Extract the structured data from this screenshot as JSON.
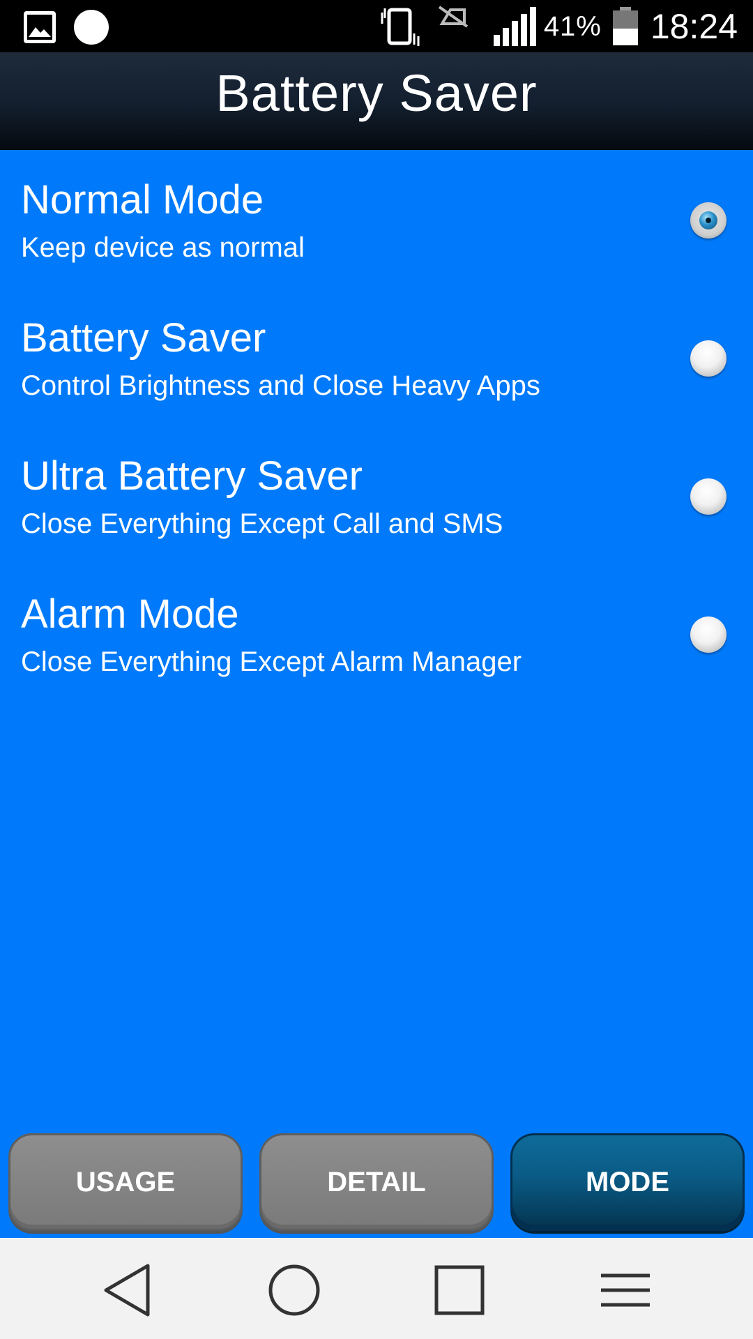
{
  "status_bar": {
    "battery_percent": "41%",
    "time": "18:24",
    "icons": [
      "image-icon",
      "notification-dot-icon",
      "vibrate-icon",
      "no-sim-icon",
      "signal-icon",
      "battery-icon"
    ]
  },
  "header": {
    "title": "Battery Saver"
  },
  "modes": [
    {
      "title": "Normal Mode",
      "description": "Keep device as normal",
      "selected": true
    },
    {
      "title": "Battery Saver",
      "description": "Control Brightness and Close Heavy Apps",
      "selected": false
    },
    {
      "title": "Ultra Battery Saver",
      "description": "Close Everything Except Call and SMS",
      "selected": false
    },
    {
      "title": "Alarm Mode",
      "description": "Close Everything Except Alarm Manager",
      "selected": false
    }
  ],
  "tabs": [
    {
      "label": "USAGE",
      "active": false
    },
    {
      "label": "DETAIL",
      "active": false
    },
    {
      "label": "MODE",
      "active": true
    }
  ],
  "nav_bar": {
    "icons": [
      "back-icon",
      "home-icon",
      "recents-icon",
      "menu-icon"
    ]
  },
  "colors": {
    "background": "#007AFA",
    "header_dark": "#0A1420",
    "tab_active": "#0A5A85",
    "tab_inactive": "#808080",
    "nav_bar": "#F2F2F2"
  }
}
